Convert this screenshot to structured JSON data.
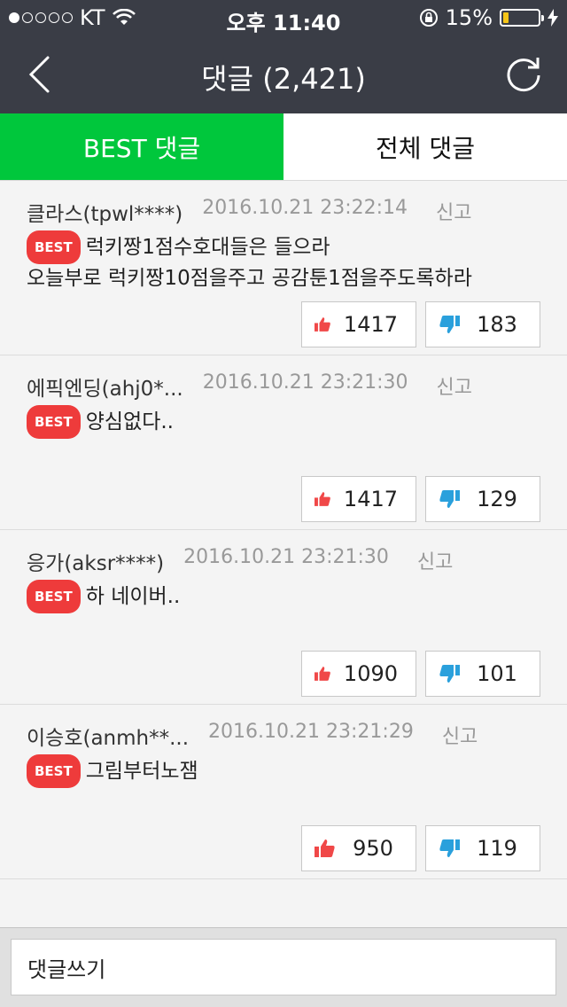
{
  "status_bar": {
    "carrier": "KT",
    "time": "오후 11:40",
    "battery": "15%",
    "battery_level": 0.15
  },
  "header": {
    "title": "댓글 (2,421)",
    "back_icon": "chevron-left-icon",
    "refresh_icon": "refresh-icon"
  },
  "tabs": [
    {
      "label": "BEST 댓글",
      "active": true
    },
    {
      "label": "전체 댓글",
      "active": false
    }
  ],
  "best_badge": "BEST",
  "report_label": "신고",
  "comments": [
    {
      "author": "클라스(tpwl****)",
      "date": "2016.10.21 23:22:14",
      "line1": "럭키짱1점수호대들은 들으라",
      "line2": "오늘부로 럭키짱10점을주고 공감툰1점을주도록하라",
      "likes": "1417",
      "dislikes": "183"
    },
    {
      "author": "에픽엔딩(ahj0*...",
      "date": "2016.10.21 23:21:30",
      "line1": "양심없다..",
      "line2": "",
      "likes": "1417",
      "dislikes": "129"
    },
    {
      "author": "응가(aksr****)",
      "date": "2016.10.21 23:21:30",
      "line1": "하 네이버..",
      "line2": "",
      "likes": "1090",
      "dislikes": "101"
    },
    {
      "author": "이승호(anmh**...",
      "date": "2016.10.21 23:21:29",
      "line1": "그림부터노잼",
      "line2": "",
      "likes": "950",
      "dislikes": "119"
    }
  ],
  "composer": {
    "placeholder": "댓글쓰기"
  },
  "colors": {
    "header_bg": "#3a3d46",
    "active_tab": "#00c73c",
    "best_badge": "#ee3b3b",
    "like_icon": "#f04848",
    "dislike_icon": "#2aa0dc"
  }
}
